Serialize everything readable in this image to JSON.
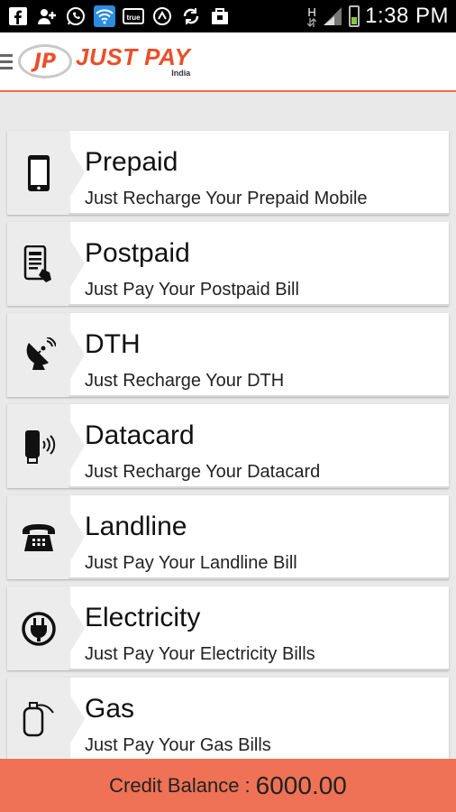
{
  "status_bar": {
    "time": "1:38 PM",
    "network_label": "H",
    "icons": [
      "facebook-icon",
      "add-contact-icon",
      "whatsapp-icon",
      "wifi-icon",
      "truecaller-icon",
      "sync-icon",
      "refresh-icon",
      "bag-icon",
      "signal-icon",
      "battery-icon"
    ]
  },
  "app": {
    "logo_badge": "JP",
    "logo_title": "JUST PAY",
    "logo_sub": "India",
    "accent_color": "#ee6a45"
  },
  "services": [
    {
      "title": "Prepaid",
      "subtitle": "Just Recharge Your Prepaid Mobile",
      "icon": "mobile-phone-icon"
    },
    {
      "title": "Postpaid",
      "subtitle": "Just Pay Your Postpaid Bill",
      "icon": "bill-tap-icon"
    },
    {
      "title": "DTH",
      "subtitle": "Just Recharge Your DTH",
      "icon": "satellite-dish-icon"
    },
    {
      "title": "Datacard",
      "subtitle": "Just Recharge Your Datacard",
      "icon": "usb-modem-icon"
    },
    {
      "title": "Landline",
      "subtitle": "Just Pay Your Landline Bill",
      "icon": "telephone-icon"
    },
    {
      "title": "Electricity",
      "subtitle": "Just Pay Your Electricity Bills",
      "icon": "plug-icon"
    },
    {
      "title": "Gas",
      "subtitle": "Just Pay Your Gas Bills",
      "icon": "gas-cylinder-icon"
    }
  ],
  "footer": {
    "label": "Credit Balance :",
    "value": "6000.00"
  }
}
